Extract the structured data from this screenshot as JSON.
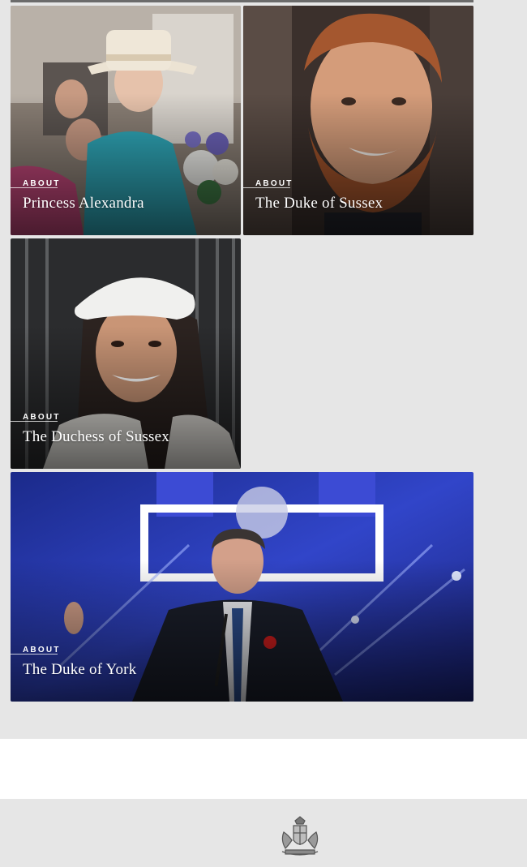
{
  "cards": [
    {
      "label": "ABOUT",
      "title": "Princess Alexandra"
    },
    {
      "label": "ABOUT",
      "title": "The Duke of Sussex"
    },
    {
      "label": "ABOUT",
      "title": "The Duchess of Sussex"
    },
    {
      "label": "ABOUT",
      "title": "The Duke of York"
    }
  ],
  "footer": {
    "crest_icon": "royal-coat-of-arms-icon"
  },
  "colors": {
    "background": "#e6e6e6",
    "white_band": "#ffffff",
    "card_text": "#ffffff"
  }
}
